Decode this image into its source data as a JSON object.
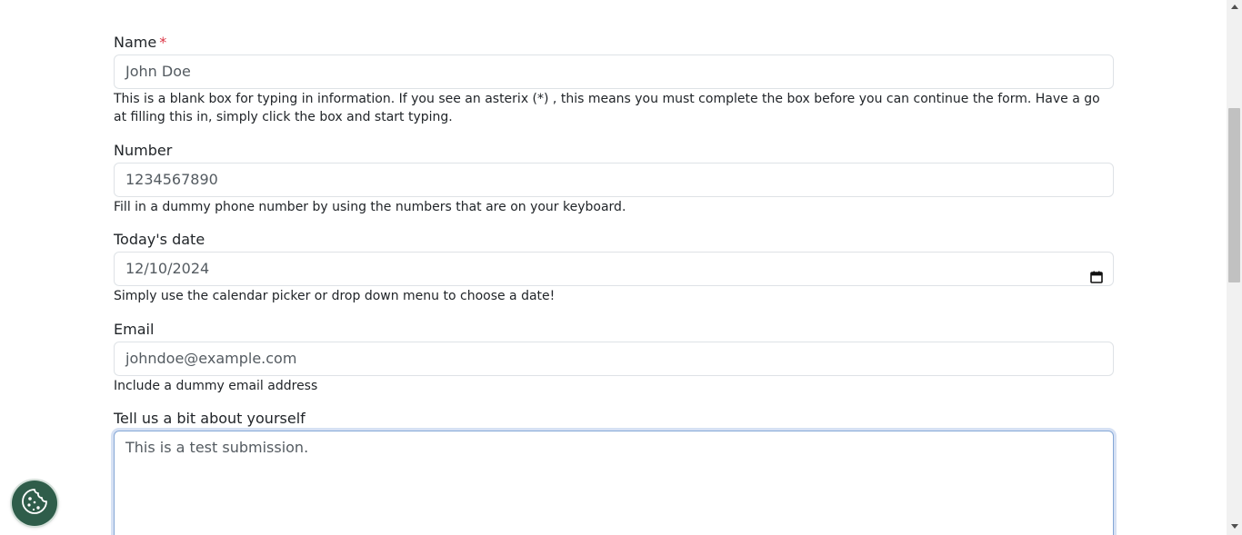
{
  "form": {
    "name": {
      "label": "Name",
      "required_mark": "*",
      "value": "John Doe",
      "help": "This is a blank box for typing in information. If you see an asterix (*) , this means you must complete the box before you can continue the form. Have a go at filling this in, simply click the box and start typing."
    },
    "number": {
      "label": "Number",
      "value": "1234567890",
      "help": "Fill in a dummy phone number by using the numbers that are on your keyboard."
    },
    "date": {
      "label": "Today's date",
      "value": "12/10/2024",
      "help": "Simply use the calendar picker or drop down menu to choose a date!"
    },
    "email": {
      "label": "Email",
      "value": "johndoe@example.com",
      "help": "Include a dummy email address"
    },
    "about": {
      "label": "Tell us a bit about yourself",
      "value": "This is a test submission."
    }
  },
  "icons": {
    "calendar": "calendar-icon",
    "cookie": "cookie-icon",
    "scroll_up": "chevron-up-icon",
    "scroll_down": "chevron-down-icon"
  },
  "colors": {
    "required": "#dc3545",
    "input_border": "#dee2e6",
    "focus_border": "#86a8d6",
    "cookie_button": "#2f5d4a",
    "scroll_thumb": "#c1c1c1"
  }
}
